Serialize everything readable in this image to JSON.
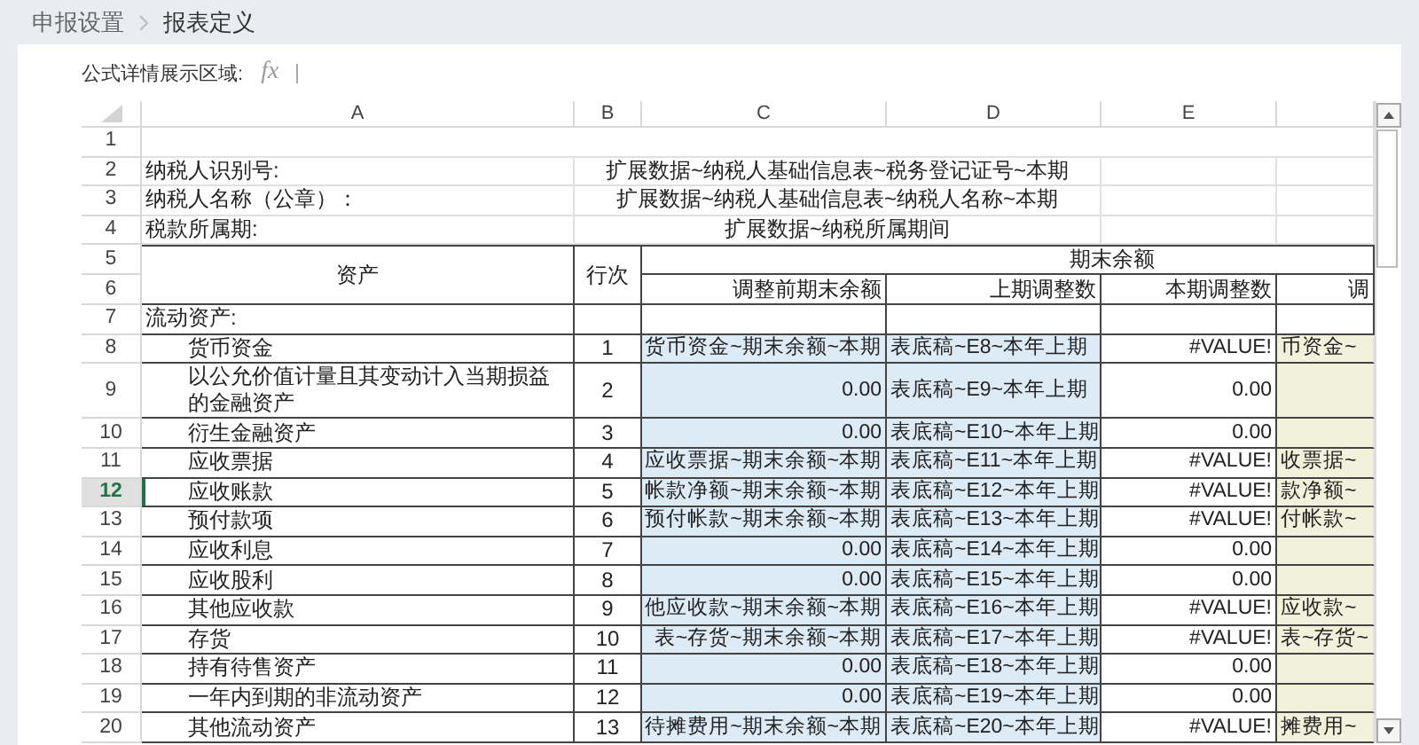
{
  "breadcrumb": [
    {
      "label": "申报设置",
      "current": false
    },
    {
      "label": "报表定义",
      "current": true
    }
  ],
  "formula_bar": {
    "label": "公式详情展示区域:",
    "icon": "fx"
  },
  "columns": [
    "A",
    "B",
    "C",
    "D",
    "E"
  ],
  "row_numbers": [
    {
      "label": "1",
      "selected": false
    },
    {
      "label": "2",
      "selected": false
    },
    {
      "label": "3",
      "selected": false
    },
    {
      "label": "4",
      "selected": false
    },
    {
      "label": "5",
      "selected": false
    },
    {
      "label": "6",
      "selected": false
    },
    {
      "label": "7",
      "selected": false
    },
    {
      "label": "8",
      "selected": false
    },
    {
      "label": "9",
      "selected": false
    },
    {
      "label": "10",
      "selected": false
    },
    {
      "label": "11",
      "selected": false
    },
    {
      "label": "12",
      "selected": true
    },
    {
      "label": "13",
      "selected": false
    },
    {
      "label": "14",
      "selected": false
    },
    {
      "label": "15",
      "selected": false
    },
    {
      "label": "16",
      "selected": false
    },
    {
      "label": "17",
      "selected": false
    },
    {
      "label": "18",
      "selected": false
    },
    {
      "label": "19",
      "selected": false
    },
    {
      "label": "20",
      "selected": false
    }
  ],
  "info_rows": [
    {
      "label": "纳税人识别号:",
      "value": "扩展数据~纳税人基础信息表~税务登记证号~本期"
    },
    {
      "label": "纳税人名称（公章）：",
      "value": "扩展数据~纳税人基础信息表~纳税人名称~本期"
    },
    {
      "label": "税款所属期:",
      "value": "扩展数据~纳税所属期间"
    }
  ],
  "table_header": {
    "asset": "资产",
    "line_no": "行次",
    "group": "期末余额",
    "subcolumns": [
      "调整前期末余额",
      "上期调整数",
      "本期调整数",
      "调"
    ]
  },
  "section": "流动资产:",
  "items": [
    {
      "name": "货币资金",
      "line": "1",
      "before": "货币资金~期末余额~本期",
      "prev_adj": "表底稿~E8~本年上期",
      "cur_adj": "#VALUE!",
      "after": "币资金~"
    },
    {
      "name": "以公允价值计量且其变动计入当期损益的金融资产",
      "line": "2",
      "before": "0.00",
      "prev_adj": "表底稿~E9~本年上期",
      "cur_adj": "0.00"
    },
    {
      "name": "衍生金融资产",
      "line": "3",
      "before": "0.00",
      "prev_adj": "表底稿~E10~本年上期",
      "cur_adj": "0.00"
    },
    {
      "name": "应收票据",
      "line": "4",
      "before": "应收票据~期末余额~本期",
      "prev_adj": "表底稿~E11~本年上期",
      "cur_adj": "#VALUE!",
      "after": "收票据~"
    },
    {
      "name": "应收账款",
      "line": "5",
      "before": "帐款净额~期末余额~本期",
      "prev_adj": "表底稿~E12~本年上期",
      "cur_adj": "#VALUE!",
      "after": "款净额~"
    },
    {
      "name": "预付款项",
      "line": "6",
      "before": "预付帐款~期末余额~本期",
      "prev_adj": "表底稿~E13~本年上期",
      "cur_adj": "#VALUE!",
      "after": "付帐款~"
    },
    {
      "name": "应收利息",
      "line": "7",
      "before": "0.00",
      "prev_adj": "表底稿~E14~本年上期",
      "cur_adj": "0.00"
    },
    {
      "name": "应收股利",
      "line": "8",
      "before": "0.00",
      "prev_adj": "表底稿~E15~本年上期",
      "cur_adj": "0.00"
    },
    {
      "name": "其他应收款",
      "line": "9",
      "before": "他应收款~期末余额~本期",
      "prev_adj": "表底稿~E16~本年上期",
      "cur_adj": "#VALUE!",
      "after": "应收款~"
    },
    {
      "name": "存货",
      "line": "10",
      "before": "表~存货~期末余额~本期",
      "prev_adj": "表底稿~E17~本年上期",
      "cur_adj": "#VALUE!",
      "after": "表~存货~"
    },
    {
      "name": "持有待售资产",
      "line": "11",
      "before": "0.00",
      "prev_adj": "表底稿~E18~本年上期",
      "cur_adj": "0.00"
    },
    {
      "name": "一年内到期的非流动资产",
      "line": "12",
      "before": "0.00",
      "prev_adj": "表底稿~E19~本年上期",
      "cur_adj": "0.00"
    },
    {
      "name": "其他流动资产",
      "line": "13",
      "before": "待摊费用~期末余额~本期",
      "prev_adj": "表底稿~E20~本年上期",
      "cur_adj": "#VALUE!",
      "after": "摊费用~"
    }
  ]
}
